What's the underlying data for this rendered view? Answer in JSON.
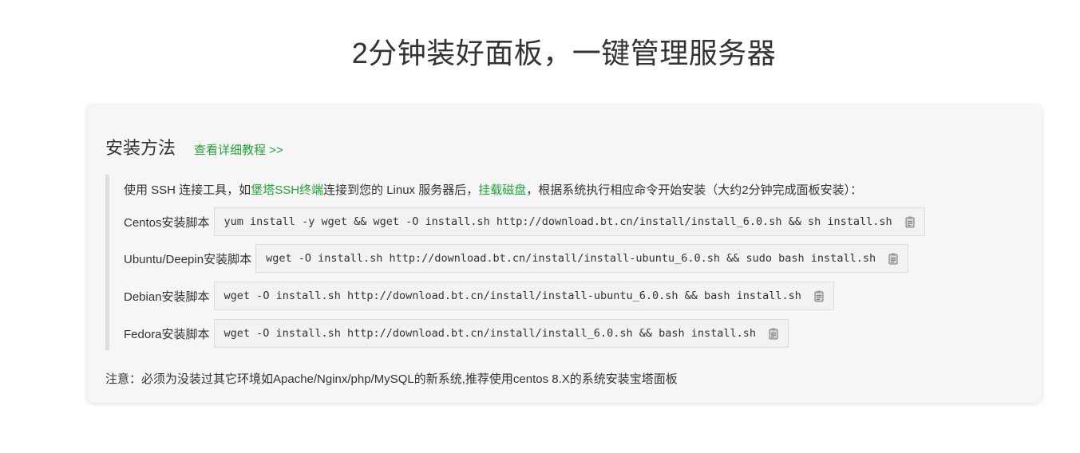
{
  "hero": {
    "title": "2分钟装好面板，一键管理服务器"
  },
  "install": {
    "section_title": "安装方法",
    "tutorial_link": "查看详细教程 >>",
    "intro": {
      "part1": "使用 SSH 连接工具，如",
      "link_ssh_terminal": "堡塔SSH终端",
      "part2": "连接到您的 Linux 服务器后，",
      "link_mount_disk": "挂载磁盘",
      "part3": "，根据系统执行相应命令开始安装（大约2分钟完成面板安装）："
    },
    "commands": [
      {
        "label": "Centos安装脚本",
        "command": "yum install -y wget && wget -O install.sh http://download.bt.cn/install/install_6.0.sh && sh install.sh"
      },
      {
        "label": "Ubuntu/Deepin安装脚本",
        "command": "wget -O install.sh http://download.bt.cn/install/install-ubuntu_6.0.sh && sudo bash install.sh"
      },
      {
        "label": "Debian安装脚本",
        "command": "wget -O install.sh http://download.bt.cn/install/install-ubuntu_6.0.sh && bash install.sh"
      },
      {
        "label": "Fedora安装脚本",
        "command": "wget -O install.sh http://download.bt.cn/install/install_6.0.sh && bash install.sh"
      }
    ],
    "copy_icon": "clipboard-icon",
    "note": "注意：必须为没装过其它环境如Apache/Nginx/php/MySQL的新系统,推荐使用centos 8.X的系统安装宝塔面板"
  },
  "colors": {
    "accent_green": "#20a53a",
    "text": "#333333",
    "panel_bg": "#f6f6f6",
    "code_bg": "#f2f2f2",
    "border": "#dddddd"
  }
}
